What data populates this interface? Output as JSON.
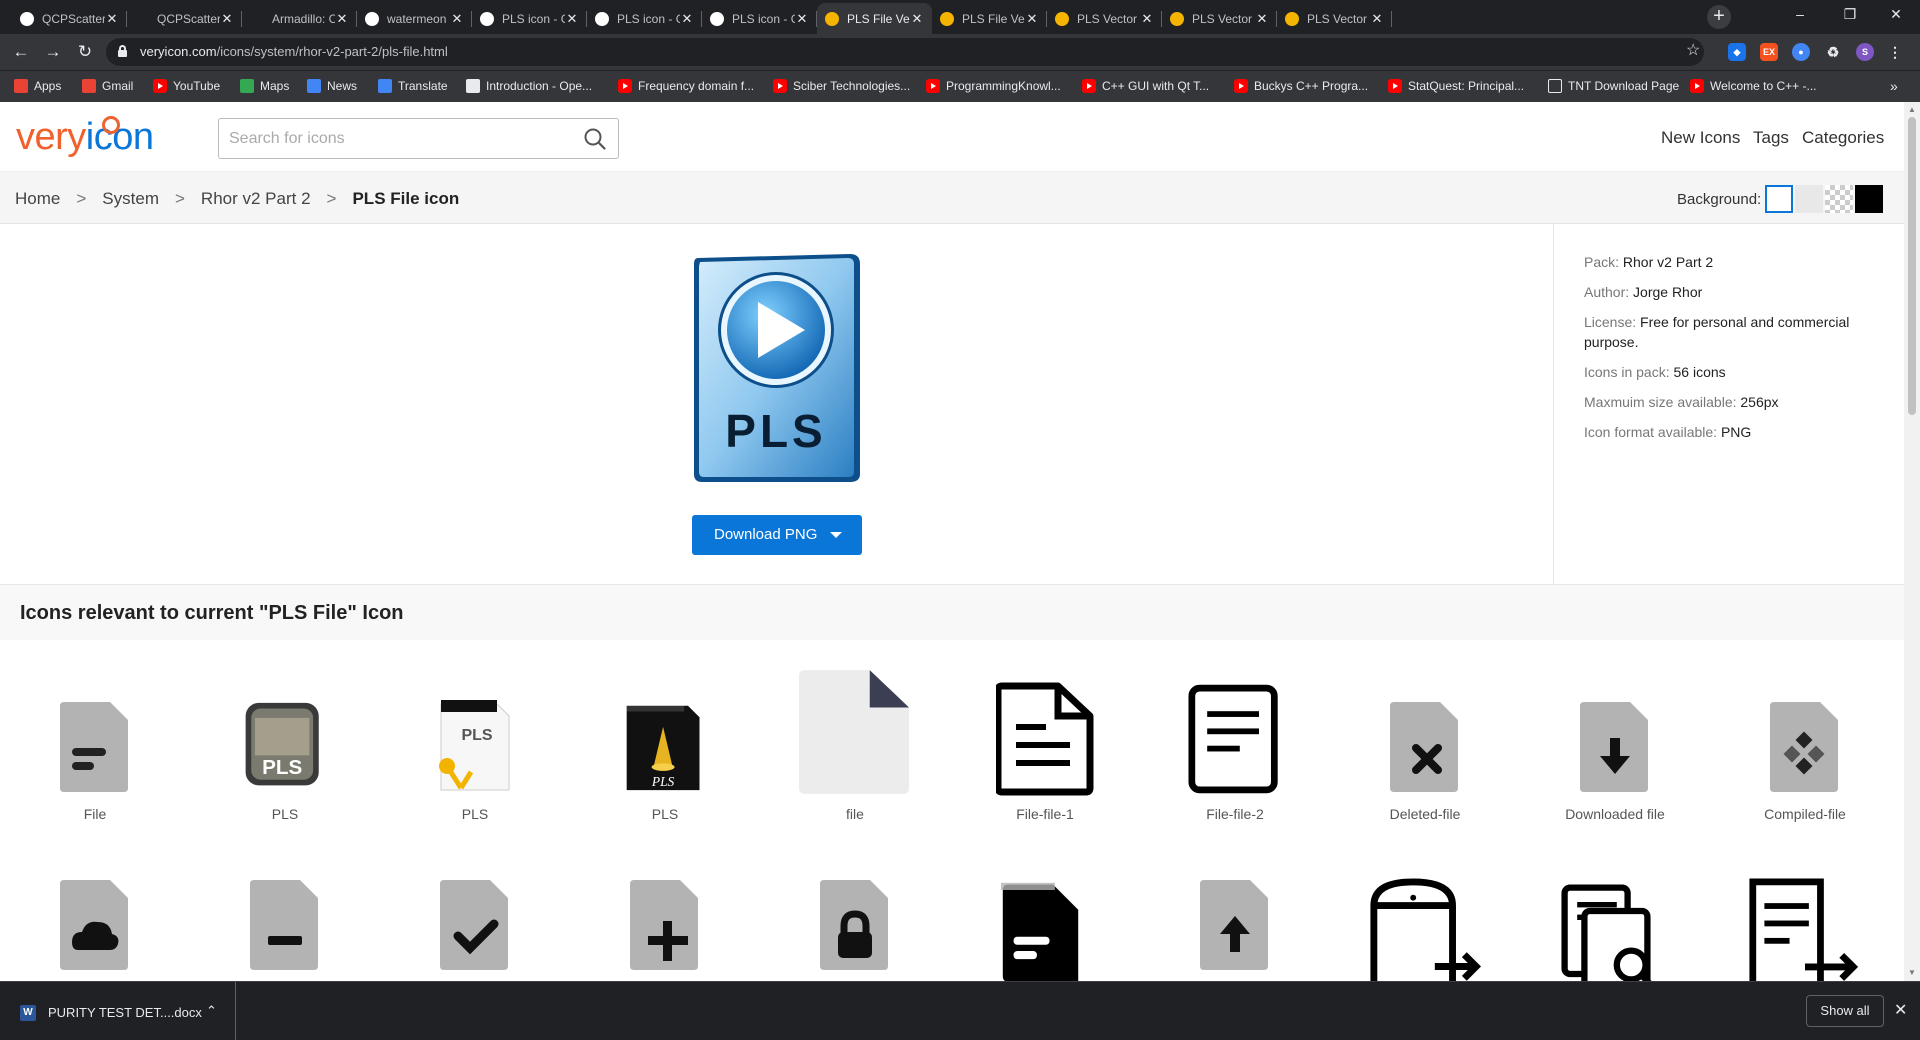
{
  "browser": {
    "tabs": [
      {
        "title": "QCPScatterSty",
        "fav": "G"
      },
      {
        "title": "QCPScatterSty",
        "fav": "~"
      },
      {
        "title": "Armadillo: C++",
        "fav": "A"
      },
      {
        "title": "watermeon - s",
        "fav": "M"
      },
      {
        "title": "PLS icon - Goo",
        "fav": "G"
      },
      {
        "title": "PLS icon - Goo",
        "fav": "G"
      },
      {
        "title": "PLS icon - Goo",
        "fav": "G"
      },
      {
        "title": "PLS File Vector",
        "fav": "v",
        "active": true
      },
      {
        "title": "PLS File Vecto",
        "fav": "v"
      },
      {
        "title": "PLS Vector Ico",
        "fav": "v"
      },
      {
        "title": "PLS Vector Ico",
        "fav": "v"
      },
      {
        "title": "PLS Vector Ico",
        "fav": "v"
      }
    ],
    "url_domain": "veryicon.com",
    "url_path": "/icons/system/rhor-v2-part-2/pls-file.html",
    "profile_initial": "S",
    "bookmarks": [
      {
        "label": "Apps",
        "icon": "apps-grid-icon"
      },
      {
        "label": "Gmail",
        "icon": "gmail-icon"
      },
      {
        "label": "YouTube",
        "icon": "youtube-icon"
      },
      {
        "label": "Maps",
        "icon": "maps-icon"
      },
      {
        "label": "News",
        "icon": "news-icon"
      },
      {
        "label": "Translate",
        "icon": "translate-icon"
      },
      {
        "label": "Introduction - Ope...",
        "icon": "globe-icon"
      },
      {
        "label": "Frequency domain f...",
        "icon": "youtube-icon"
      },
      {
        "label": "Sciber Technologies...",
        "icon": "youtube-icon"
      },
      {
        "label": "ProgrammingKnowl...",
        "icon": "youtube-icon"
      },
      {
        "label": "C++ GUI with Qt T...",
        "icon": "youtube-icon"
      },
      {
        "label": "Buckys C++ Progra...",
        "icon": "youtube-icon"
      },
      {
        "label": "StatQuest: Principal...",
        "icon": "youtube-icon"
      },
      {
        "label": "TNT Download Page",
        "icon": "page-icon"
      },
      {
        "label": "Welcome to C++ -...",
        "icon": "youtube-icon"
      }
    ]
  },
  "site": {
    "logo_part1": "very",
    "logo_part2": "icon",
    "search_placeholder": "Search for icons",
    "nav": [
      "New Icons",
      "Tags",
      "Categories"
    ]
  },
  "breadcrumb": {
    "items": [
      "Home",
      "System",
      "Rhor v2 Part 2"
    ],
    "current": "PLS File icon",
    "separator": ">"
  },
  "background_label": "Background:",
  "hero": {
    "icon_text": "PLS",
    "download_label": "Download PNG"
  },
  "info": [
    {
      "key": "Pack:",
      "value": "Rhor v2 Part 2"
    },
    {
      "key": "Author:",
      "value": "Jorge Rhor"
    },
    {
      "key": "License:",
      "value": "Free for personal and commercial purpose."
    },
    {
      "key": "Icons in pack:",
      "value": "56 icons"
    },
    {
      "key": "Maxmuim size available:",
      "value": "256px"
    },
    {
      "key": "Icon format available:",
      "value": "PNG"
    }
  ],
  "related": {
    "heading": "Icons relevant to current \"PLS File\" Icon",
    "row1": [
      {
        "label": "File",
        "icon": "file-lines-icon"
      },
      {
        "label": "PLS",
        "icon": "pls-stone-icon"
      },
      {
        "label": "PLS",
        "icon": "pls-clapper-white-icon"
      },
      {
        "label": "PLS",
        "icon": "pls-clapper-black-icon"
      },
      {
        "label": "file",
        "icon": "blank-file-icon"
      },
      {
        "label": "File-file-1",
        "icon": "file-outline-1-icon"
      },
      {
        "label": "File-file-2",
        "icon": "file-outline-2-icon"
      },
      {
        "label": "Deleted-file",
        "icon": "file-deleted-icon"
      },
      {
        "label": "Downloaded file",
        "icon": "file-download-icon"
      },
      {
        "label": "Compiled-file",
        "icon": "file-compiled-icon"
      }
    ],
    "row2": [
      {
        "icon": "file-cloud-icon"
      },
      {
        "icon": "file-minus-icon"
      },
      {
        "icon": "file-check-icon"
      },
      {
        "icon": "file-plus-icon"
      },
      {
        "icon": "file-lock-icon"
      },
      {
        "icon": "file-black-icon"
      },
      {
        "icon": "file-upload-icon"
      },
      {
        "icon": "file-export-icon"
      },
      {
        "icon": "file-search-icon"
      },
      {
        "icon": "file-list-export-icon"
      }
    ]
  },
  "download_shelf": {
    "file_name": "PURITY TEST DET....docx",
    "show_all": "Show all"
  }
}
